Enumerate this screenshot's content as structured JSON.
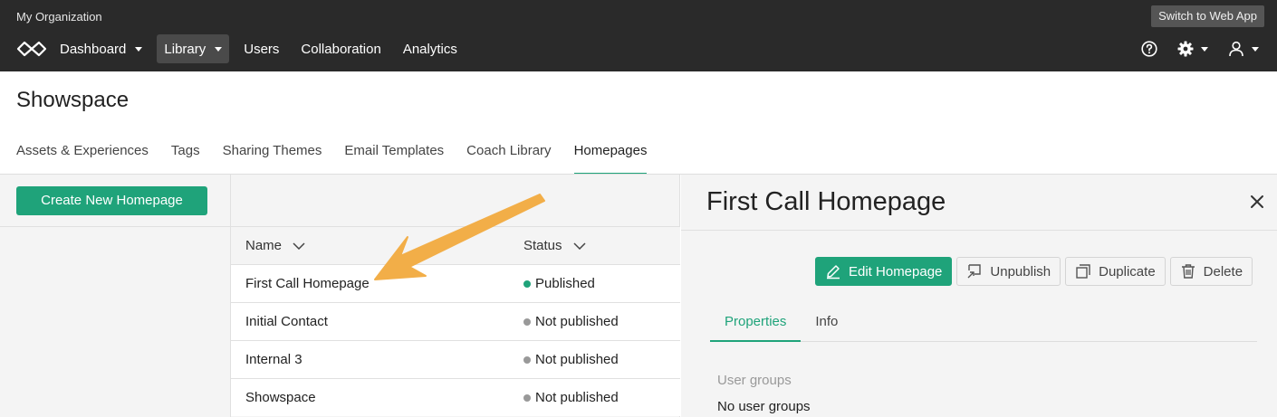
{
  "topbar": {
    "org_name": "My Organization",
    "switch_label": "Switch to Web App",
    "nav": [
      {
        "label": "Dashboard",
        "dropdown": true,
        "active": false
      },
      {
        "label": "Library",
        "dropdown": true,
        "active": true
      },
      {
        "label": "Users",
        "dropdown": false,
        "active": false
      },
      {
        "label": "Collaboration",
        "dropdown": false,
        "active": false
      },
      {
        "label": "Analytics",
        "dropdown": false,
        "active": false
      }
    ],
    "icons": [
      "help-icon",
      "gear-icon",
      "user-icon"
    ]
  },
  "page": {
    "title": "Showspace",
    "tabs": [
      {
        "label": "Assets & Experiences",
        "active": false
      },
      {
        "label": "Tags",
        "active": false
      },
      {
        "label": "Sharing Themes",
        "active": false
      },
      {
        "label": "Email Templates",
        "active": false
      },
      {
        "label": "Coach Library",
        "active": false
      },
      {
        "label": "Homepages",
        "active": true
      }
    ]
  },
  "left": {
    "create_label": "Create New Homepage"
  },
  "list": {
    "columns": {
      "name": "Name",
      "status": "Status"
    },
    "rows": [
      {
        "name": "First Call Homepage",
        "status": "Published"
      },
      {
        "name": "Initial Contact",
        "status": "Not published"
      },
      {
        "name": "Internal 3",
        "status": "Not published"
      },
      {
        "name": "Showspace",
        "status": "Not published"
      }
    ]
  },
  "detail": {
    "title": "First Call Homepage",
    "actions": {
      "edit": "Edit Homepage",
      "unpublish": "Unpublish",
      "duplicate": "Duplicate",
      "delete": "Delete"
    },
    "tabs": [
      {
        "label": "Properties",
        "active": true
      },
      {
        "label": "Info",
        "active": false
      }
    ],
    "user_groups_label": "User groups",
    "user_groups_value": "No user groups"
  },
  "colors": {
    "accent": "#1fa37a",
    "topbar": "#2a2a2a",
    "published_dot": "#1fa37a",
    "unpublished_dot": "#999999",
    "arrow": "#f2ae48"
  }
}
